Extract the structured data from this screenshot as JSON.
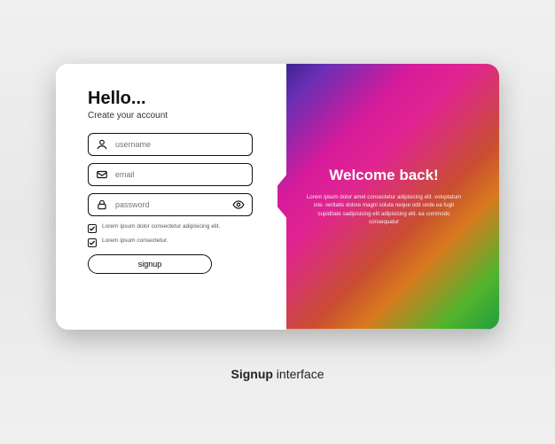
{
  "form": {
    "heading": "Hello...",
    "subheading": "Create your account",
    "fields": {
      "username": {
        "placeholder": "username"
      },
      "email": {
        "placeholder": "email"
      },
      "password": {
        "placeholder": "password"
      }
    },
    "checks": [
      "Lorem ipsum dolor consectetur adipisicing elit.",
      "Lorem ipsum consectetur."
    ],
    "button": "signup"
  },
  "welcome": {
    "title": "Welcome back!",
    "body": "Lorem ipsum dolor amet consectetur adipisicing elit. voluptatum iste. veritatis dolore magni soluta neque odit unde ea fugit cupiditate sadipisicing elit adipisicing elit. ea commodo consequatur"
  },
  "caption": {
    "bold": "Signup",
    "rest": " interface"
  }
}
